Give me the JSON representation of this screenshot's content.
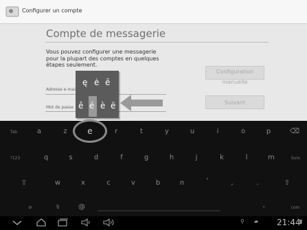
{
  "window": {
    "title": "Configurer un compte"
  },
  "page": {
    "heading": "Compte de messagerie",
    "description": "Vous pouvez configurer une messagerie pour la plupart des comptes en quelques étapes seulement.",
    "email_label": "Adresse e-mail",
    "password_label": "Mot de passe",
    "config_button": "Configuration manuelle",
    "next_button": "Suivant"
  },
  "accent_popup": {
    "row1": [
      "ę",
      "ė",
      "ē"
    ],
    "row2": [
      "ê",
      "é",
      "è",
      "ë"
    ]
  },
  "keyboard": {
    "row1": [
      "Tab",
      "a",
      "z",
      "e",
      "r",
      "t",
      "y",
      "u",
      "i",
      "o",
      "p",
      "⌫"
    ],
    "row2": [
      "?123",
      "q",
      "s",
      "d",
      "f",
      "g",
      "h",
      "j",
      "k",
      "l",
      "m",
      "Suiv."
    ],
    "row3": [
      "⇧",
      "w",
      "x",
      "c",
      "v",
      "b",
      "n",
      "'",
      ",",
      ".",
      "⇧"
    ],
    "row4": [
      "⚙",
      "🎙",
      "@",
      "-",
      "com"
    ]
  },
  "status_bar": {
    "time": "21:44"
  },
  "colors": {
    "keyboard_bg": "#111111",
    "content_bg": "#e8e8e8"
  }
}
